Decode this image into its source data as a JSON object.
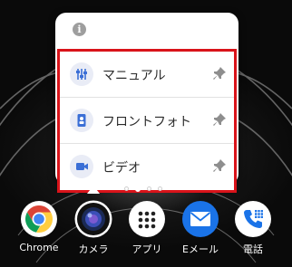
{
  "popup": {
    "header_icon": "info-icon",
    "shortcuts": [
      {
        "label": "マニュアル",
        "icon": "manual-sliders-icon",
        "pin_icon": "pin-icon"
      },
      {
        "label": "フロントフォト",
        "icon": "front-camera-icon",
        "pin_icon": "pin-icon"
      },
      {
        "label": "ビデオ",
        "icon": "video-camera-icon",
        "pin_icon": "pin-icon"
      }
    ],
    "highlight_color": "#d9131a",
    "accent_color": "#3b6fd6"
  },
  "page_indicator": {
    "count": 4,
    "active_index": 1
  },
  "dock": [
    {
      "label": "Chrome",
      "icon": "chrome-icon"
    },
    {
      "label": "カメラ",
      "icon": "camera-icon"
    },
    {
      "label": "アプリ",
      "icon": "apps-grid-icon"
    },
    {
      "label": "Eメール",
      "icon": "email-icon"
    },
    {
      "label": "電話",
      "icon": "phone-icon"
    }
  ]
}
